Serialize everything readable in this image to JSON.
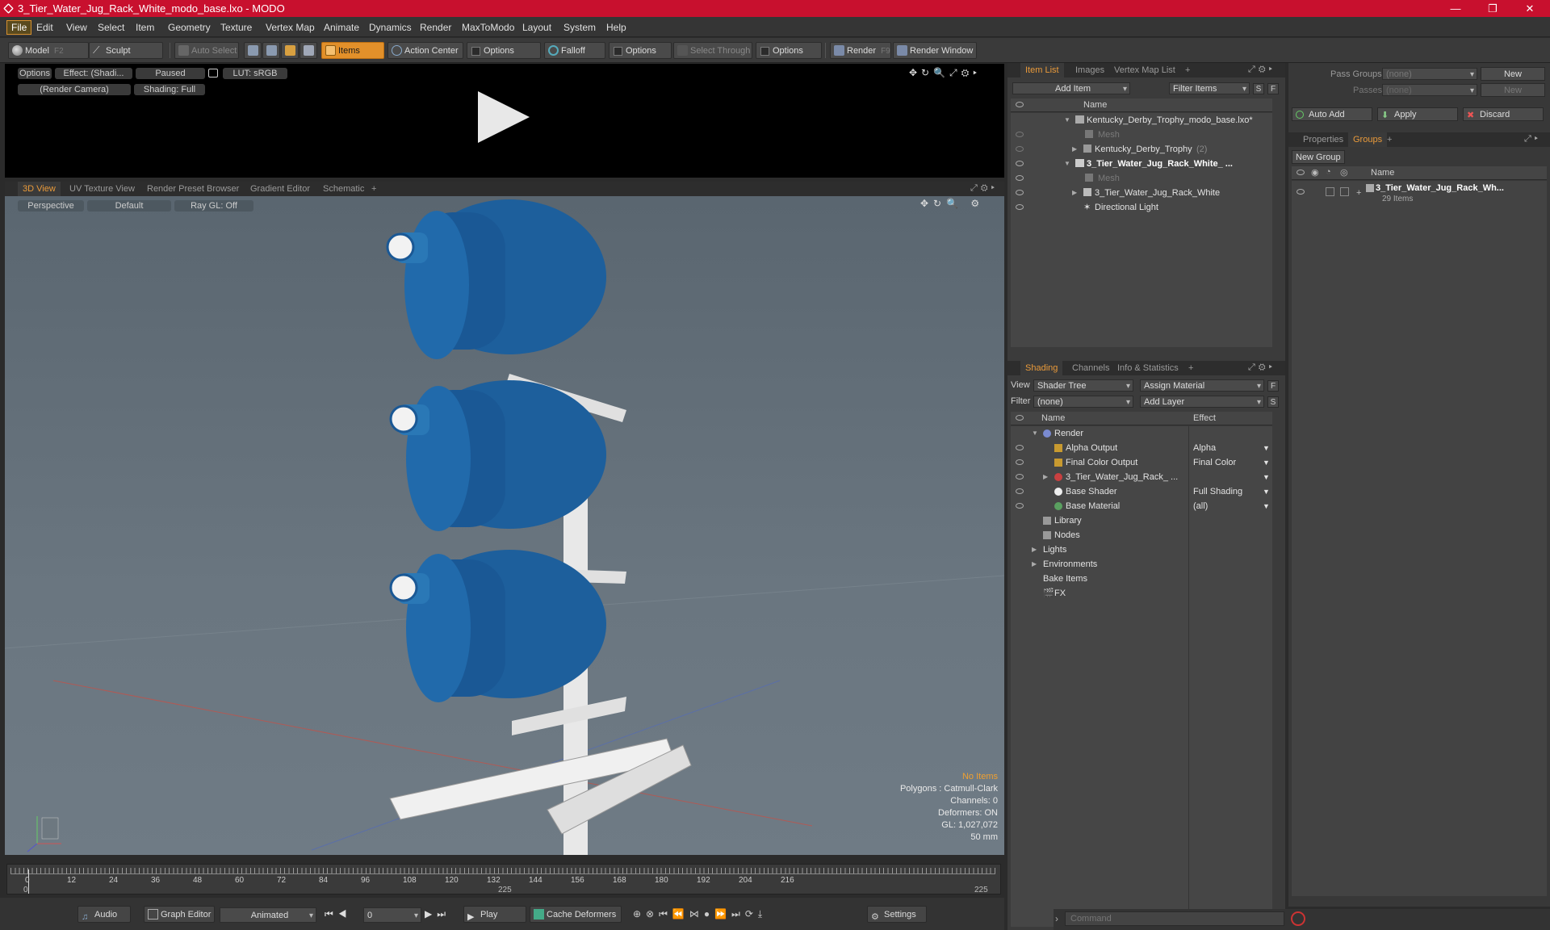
{
  "window": {
    "title": "3_Tier_Water_Jug_Rack_White_modo_base.lxo - MODO",
    "minimize": "—",
    "maximize": "❐",
    "close": "✕"
  },
  "menu": [
    "File",
    "Edit",
    "View",
    "Select",
    "Item",
    "Geometry",
    "Texture",
    "Vertex Map",
    "Animate",
    "Dynamics",
    "Render",
    "MaxToModo",
    "Layout",
    "System",
    "Help"
  ],
  "toolbar": {
    "model": "Model",
    "model_key": "F2",
    "sculpt": "Sculpt",
    "auto_select": "Auto Select",
    "items": "Items",
    "action_center": "Action Center",
    "options1": "Options",
    "falloff": "Falloff",
    "options2": "Options",
    "select_through": "Select Through",
    "options3": "Options",
    "render": "Render",
    "render_key": "F9",
    "render_window": "Render Window"
  },
  "render_view": {
    "options": "Options",
    "effect": "Effect: (Shadi...",
    "paused": "Paused",
    "lut": "LUT: sRGB",
    "camera": "(Render Camera)",
    "shading": "Shading: Full"
  },
  "viewport_tabs": [
    "3D View",
    "UV Texture View",
    "Render Preset Browser",
    "Gradient Editor",
    "Schematic",
    "+"
  ],
  "viewport": {
    "perspective": "Perspective",
    "default": "Default",
    "raygl": "Ray GL: Off",
    "no_items": "No Items",
    "stats": [
      "Polygons : Catmull-Clark",
      "Channels: 0",
      "Deformers: ON",
      "GL: 1,027,072",
      "50 mm"
    ]
  },
  "timeline": {
    "ticks": [
      "0",
      "12",
      "24",
      "36",
      "48",
      "60",
      "72",
      "84",
      "96",
      "108",
      "120",
      "132",
      "144",
      "156",
      "168",
      "180",
      "192",
      "204",
      "216"
    ],
    "start": "0",
    "mid": "225",
    "end": "225"
  },
  "bottom": {
    "audio": "Audio",
    "graph_editor": "Graph Editor",
    "animated": "Animated",
    "frame": "0",
    "play": "Play",
    "cache": "Cache Deformers",
    "settings": "Settings"
  },
  "item_list": {
    "tabs": [
      "Item List",
      "Images",
      "Vertex Map List",
      "+"
    ],
    "add_item": "Add Item",
    "filter": "Filter Items",
    "s": "S",
    "f": "F",
    "col_name": "Name",
    "rows": [
      {
        "label": "Kentucky_Derby_Trophy_modo_base.lxo*",
        "count": ""
      },
      {
        "label": "Mesh",
        "count": ""
      },
      {
        "label": "Kentucky_Derby_Trophy",
        "count": "(2)"
      },
      {
        "label": "3_Tier_Water_Jug_Rack_White_ ...",
        "count": ""
      },
      {
        "label": "Mesh",
        "count": ""
      },
      {
        "label": "3_Tier_Water_Jug_Rack_White",
        "count": ""
      },
      {
        "label": "Directional Light",
        "count": ""
      }
    ]
  },
  "shading": {
    "tabs": [
      "Shading",
      "Channels",
      "Info & Statistics",
      "+"
    ],
    "view_label": "View",
    "view_value": "Shader Tree",
    "assign": "Assign Material",
    "f": "F",
    "filter_label": "Filter",
    "filter_value": "(none)",
    "add_layer": "Add Layer",
    "s": "S",
    "col_name": "Name",
    "col_effect": "Effect",
    "rows": [
      {
        "name": "Render",
        "effect": ""
      },
      {
        "name": "Alpha Output",
        "effect": "Alpha"
      },
      {
        "name": "Final Color Output",
        "effect": "Final Color"
      },
      {
        "name": "3_Tier_Water_Jug_Rack_ ...",
        "effect": ""
      },
      {
        "name": "Base Shader",
        "effect": "Full Shading"
      },
      {
        "name": "Base Material",
        "effect": "(all)"
      },
      {
        "name": "Library",
        "effect": ""
      },
      {
        "name": "Nodes",
        "effect": ""
      },
      {
        "name": "Lights",
        "effect": ""
      },
      {
        "name": "Environments",
        "effect": ""
      },
      {
        "name": "Bake Items",
        "effect": ""
      },
      {
        "name": "FX",
        "effect": ""
      }
    ]
  },
  "groups_panel": {
    "pass_groups": "Pass Groups",
    "passes": "Passes",
    "none": "(none)",
    "new": "New",
    "auto_add": "Auto Add",
    "apply": "Apply",
    "discard": "Discard",
    "tabs": [
      "Properties",
      "Groups",
      "+"
    ],
    "new_group": "New Group",
    "col_name": "Name",
    "group_name": "3_Tier_Water_Jug_Rack_Wh...",
    "group_count": "29 Items"
  },
  "command": {
    "placeholder": "Command"
  }
}
